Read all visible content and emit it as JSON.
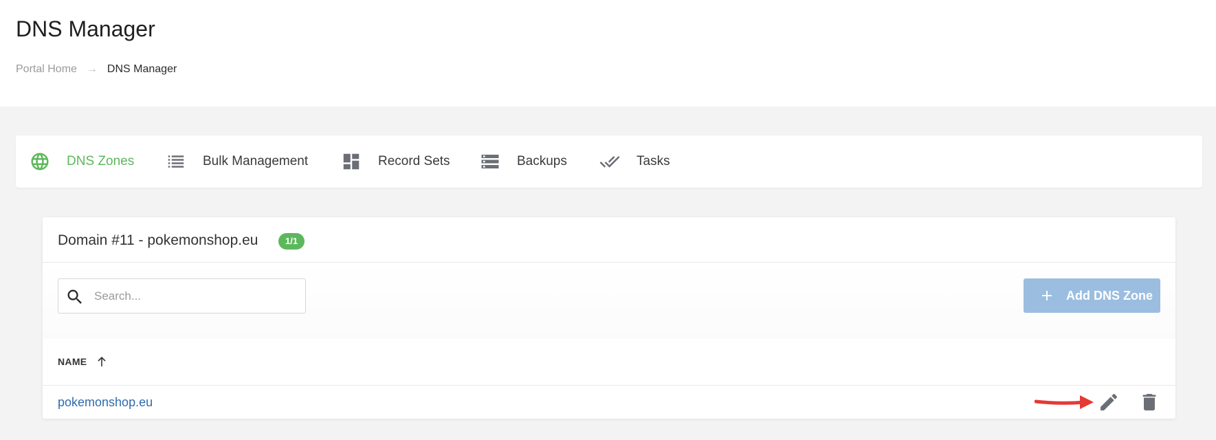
{
  "page": {
    "title": "DNS Manager"
  },
  "breadcrumb": {
    "home": "Portal Home",
    "current": "DNS Manager"
  },
  "tabs": [
    {
      "label": "DNS Zones",
      "icon": "globe-icon",
      "active": true
    },
    {
      "label": "Bulk Management",
      "icon": "list-icon",
      "active": false
    },
    {
      "label": "Record Sets",
      "icon": "dashboard-icon",
      "active": false
    },
    {
      "label": "Backups",
      "icon": "storage-icon",
      "active": false
    },
    {
      "label": "Tasks",
      "icon": "double-check-icon",
      "active": false
    }
  ],
  "card": {
    "title": "Domain #11 - pokemonshop.eu",
    "badge": "1/1"
  },
  "search": {
    "placeholder": "Search...",
    "value": ""
  },
  "add_button": {
    "label": "Add DNS Zone"
  },
  "table": {
    "columns": [
      "NAME"
    ],
    "rows": [
      {
        "name": "pokemonshop.eu"
      }
    ]
  },
  "colors": {
    "active": "#5cb85c",
    "link": "#2f6aae",
    "button": "#9bbde0",
    "annotation_arrow": "#e53935",
    "icon": "#6b6f75"
  }
}
